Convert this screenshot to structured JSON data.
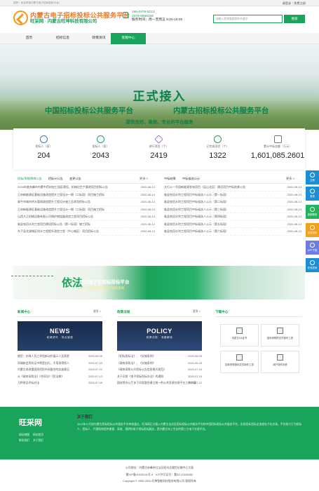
{
  "topbar": {
    "left": "您好！欢迎来到内蒙古电子招标投标平台！",
    "right": "请登录｜免费注册"
  },
  "header": {
    "logo_title": "内蒙古电子招标投标公共服务平台",
    "logo_sub": "旺采网 · 内蒙古旺坤科技有限公司",
    "phone1": "186-0476-5213",
    "phone2": "0476-8866336",
    "hours": "服务时间：周一至周五 8:00-18:00",
    "search_placeholder": "请输入您想要搜索的关键字",
    "search_btn": "搜索"
  },
  "nav": [
    "首页",
    "招标信息",
    "政策资讯",
    "客服中心"
  ],
  "banner": {
    "title": "正式接入",
    "line_a": "中国招标投标公共服务平台",
    "line_b": "内蒙古招标投标公共服务平台",
    "slogan": "提供良好、高效、专业的平台服务"
  },
  "stats": [
    {
      "label": "招标人（家）",
      "value": "204",
      "color": "#2f7de1"
    },
    {
      "label": "投标人（家）",
      "value": "2043",
      "color": "#1aa35a"
    },
    {
      "label": "进行项目（个）",
      "value": "2419",
      "color": "#8a58d6"
    },
    {
      "label": "已完成项目（个）",
      "value": "1322",
      "color": "#1aa35a"
    },
    {
      "label": "累计中标金额（万元）",
      "value": "1,601,085.2601",
      "color": "#e04848"
    }
  ],
  "left_panel": {
    "tabs": [
      "招标/资格预审公告",
      "招标计公告",
      "变更公告"
    ],
    "more": "更多 >",
    "rows": [
      {
        "t": "2024年度赤峰市内蒙中药材加工园区建设，机械化生产基地项目招标公告",
        "d": "2020-08-14"
      },
      {
        "t": "王府新能源区基础设施改造提升工程设计一期（二标段）项目施工招标",
        "d": "2020-08-14"
      },
      {
        "t": "青平市城市供水管网改造提升工程设计施工总承包招标公告",
        "d": "2020-08-13"
      },
      {
        "t": "王府新能源区基础设施改造提升工程设计一期（二标段）项目施工招标",
        "d": "2020-08-13"
      },
      {
        "t": "山西大正机械设备有限公司锅炉燃烧器改造工程项目招标公告",
        "d": "2020-08-13"
      },
      {
        "t": "临县农田水利工程项目建设招标公告（第一标段）施工招标",
        "d": "2020-08-12"
      },
      {
        "t": "东子县北湖城区排水工程提升改造工程（中心城区）项目招标公告",
        "d": "2020-08-12"
      }
    ]
  },
  "right_panel": {
    "tabs": [
      "中标结果",
      "中标候选公示"
    ],
    "more": "更多 >",
    "rows": [
      {
        "t": "太行公一号园新能源发电项目（运山北区）建设项目中标结果公告",
        "d": "2020-08-13"
      },
      {
        "t": "临县农田水利工程项目中标候选人公示（第一标段）",
        "d": "2020-08-13"
      },
      {
        "t": "临县农田水利工程项目中标候选人公示（第二标段）",
        "d": "2020-08-13"
      },
      {
        "t": "临县农田水利工程项目中标候选人公示（第三标段）",
        "d": "2020-08-13"
      },
      {
        "t": "临县农田水利工程项目中标候选人公示（第四标段）",
        "d": "2020-08-13"
      },
      {
        "t": "临县农田水利工程项目中标候选人公示（第五标段）",
        "d": "2020-08-13"
      },
      {
        "t": "临县农田水利工程项目中标候选人公示（第六标段）",
        "d": "2020-08-13"
      }
    ]
  },
  "sidebar": [
    "注册",
    "登录",
    "客服微信",
    "发布招标",
    "APP下载",
    "在线咨询"
  ],
  "ad": {
    "big": "依法",
    "t1": "建立电子化招标投标平台",
    "t2": "全力促进招标投标市场健康发展"
  },
  "news": {
    "title": "新闻中心",
    "more": "更多 >",
    "pic": "NEWS",
    "pic_sub": "权威资讯 · 热点速递",
    "rows": [
      {
        "t": "赫哲：刘海人员之寻找新动作展示人及获悉",
        "d": "2020-08-05"
      },
      {
        "t": "同城新会资料证书将是出行，不用再得投人",
        "d": "2020-07-23"
      },
      {
        "t": "内蒙古发改委国家招投市场整合的实施意见",
        "d": "2020-07-22"
      },
      {
        "t": "从《政府采购法》《合同法》《民法典》",
        "d": "2020-07-13"
      },
      {
        "t": "几种常见评标办法",
        "d": "2020-07-09"
      }
    ]
  },
  "policy": {
    "title": "政策法规",
    "more": "更多 >",
    "pic": "POLICY",
    "pic_sub": "政策法规 · 深度解读",
    "rows": [
      {
        "t": "《招标投标法》、《实施条例》",
        "d": "2020-08-05"
      },
      {
        "t": "《政府采购法》、《实施条例》",
        "d": "2020-08-05"
      },
      {
        "t": "《政府采购公开招标公告信息格式规范》",
        "d": "2020-07-24"
      },
      {
        "t": "关于印发《电子招标投标办法》的通知",
        "d": "2020-07-15"
      },
      {
        "t": "国务院办公厅关于印发整合建立统一的公共资源交易平台工作方案",
        "d": "2020-07-02"
      }
    ]
  },
  "downloads": {
    "title": "下载中心",
    "items": [
      "内蒙古CA证书",
      "招标采购的文件制作工具",
      "招标采购投标文件制作工具",
      "用户操作手册"
    ]
  },
  "footer": {
    "logo": "旺采网",
    "links": [
      "网站地图",
      "网站首页",
      "联系我们",
      "关于我们"
    ],
    "about_title": "关于我们",
    "about_text": "2019年12月经内蒙古招标投标公共服务平台审核通过，旺采网正式接入内蒙古自治区招标投标公共服务平台和中国招标投标公共服务平台，实现招标投标全流程电子化交易。平台致力于为招标人、投标人、代理机构提供便捷、高效、透明的电子招标投标服务，是内蒙古本土专业的第三方电子交易平台。"
  },
  "bottom": {
    "address": "公司地址：内蒙古赤峰市红山区昭乌达路世纪城中心大厦",
    "icp": "蒙ICP备11026241号-6　ICP许可证号：蒙B2-20180282",
    "copyright": "Copyright © 1999-2020 旺坤智能科技股份有限公司 版权所有"
  }
}
